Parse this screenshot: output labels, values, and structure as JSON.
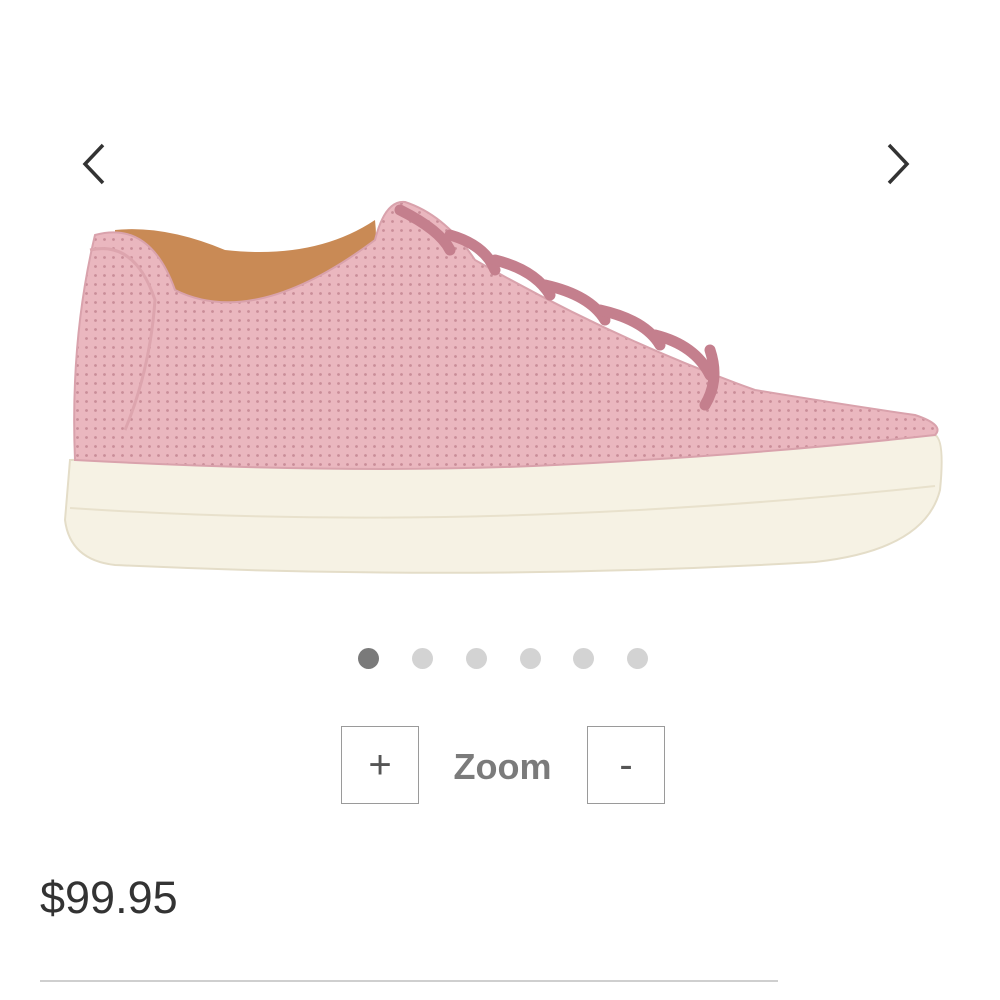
{
  "gallery": {
    "prev_icon": "chevron-left-icon",
    "next_icon": "chevron-right-icon",
    "image_count": 6,
    "active_index": 0,
    "colors": {
      "active_dot": "#7a7a7a",
      "inactive_dot": "#d3d3d3",
      "shoe_upper": "#eab7bf",
      "sole": "#f6f2e4"
    }
  },
  "zoom": {
    "plus_label": "+",
    "label": "Zoom",
    "minus_label": "-"
  },
  "product": {
    "price": "$99.95"
  }
}
